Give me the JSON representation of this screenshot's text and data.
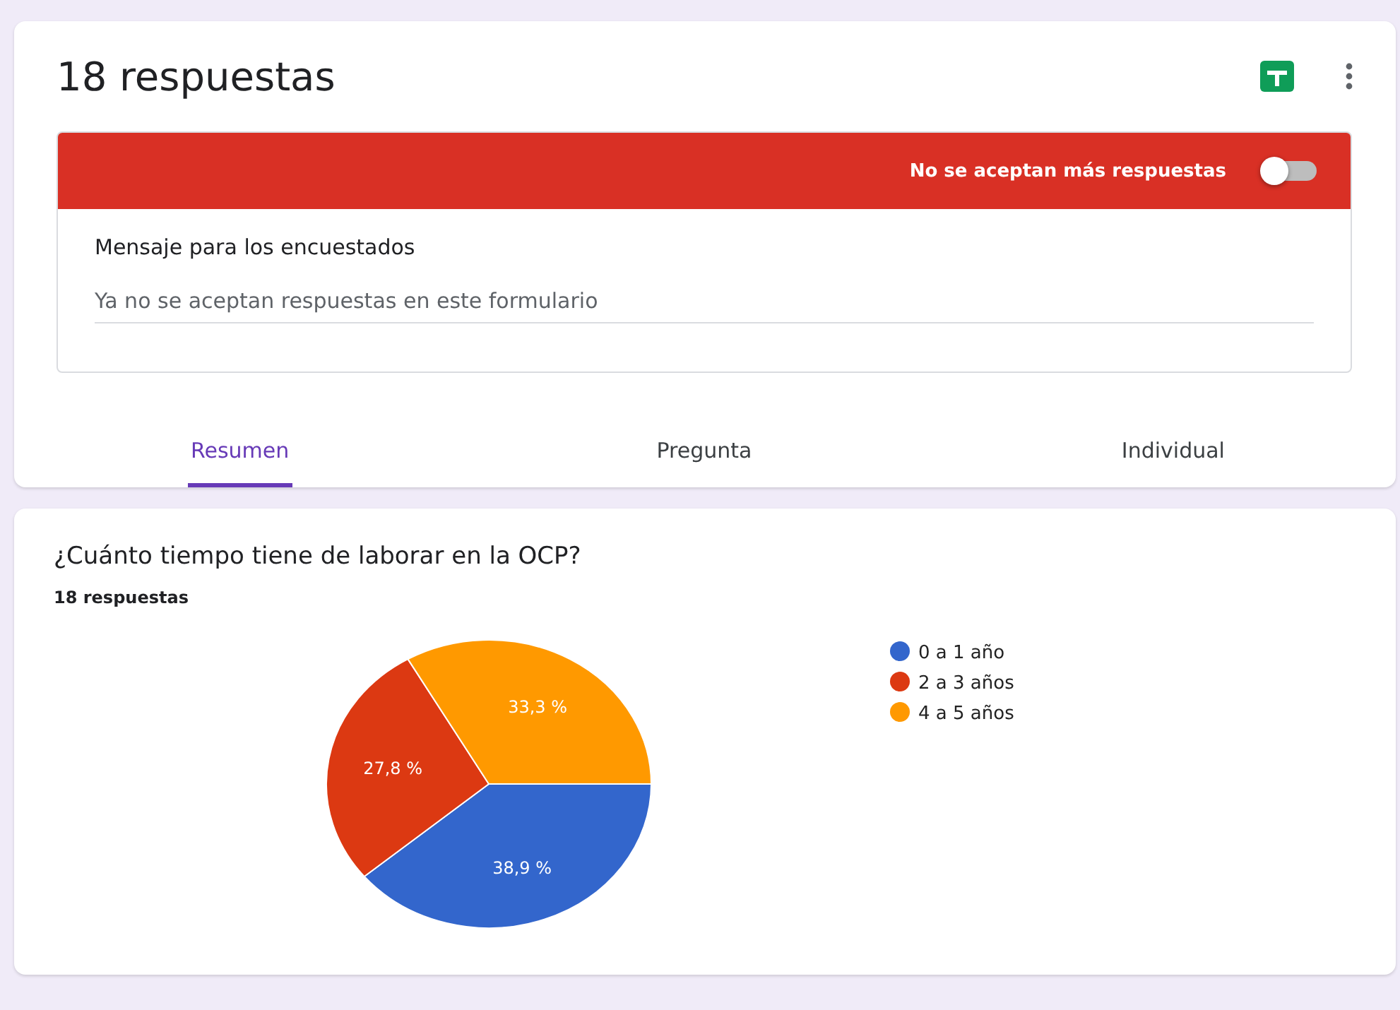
{
  "header": {
    "title": "18 respuestas"
  },
  "banner": {
    "label": "No se aceptan más respuestas",
    "accepting": false
  },
  "message": {
    "label": "Mensaje para los encuestados",
    "value": "Ya no se aceptan respuestas en este formulario"
  },
  "tabs": [
    {
      "label": "Resumen",
      "selected": true
    },
    {
      "label": "Pregunta",
      "selected": false
    },
    {
      "label": "Individual",
      "selected": false
    }
  ],
  "question": {
    "title": "¿Cuánto tiempo tiene de laborar en la OCP?",
    "count": "18 respuestas",
    "chart_data": {
      "type": "pie",
      "categories": [
        "0 a 1 año",
        "2 a 3 años",
        "4 a 5 años"
      ],
      "values": [
        38.9,
        27.8,
        33.3
      ],
      "colors": [
        "#3366cc",
        "#dc3912",
        "#ff9900"
      ],
      "legend": "right",
      "value_labels": [
        "38,9 %",
        "27,8 %",
        "33,3 %"
      ]
    }
  }
}
